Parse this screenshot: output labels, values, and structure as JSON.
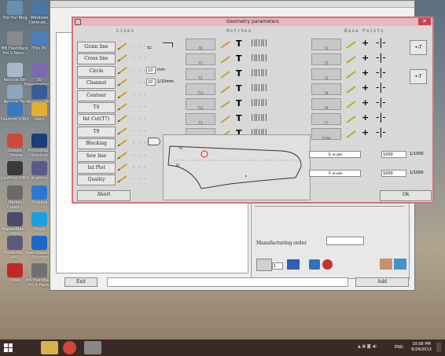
{
  "desktop_icons": [
    {
      "label": "Trio Hal Blog",
      "color": "#6a8fb0"
    },
    {
      "label": "Windows Defende...",
      "color": "#4a76a8"
    },
    {
      "label": "BB FlashBack Pro 5 Reco...",
      "color": "#8a8a8a"
    },
    {
      "label": "This PC",
      "color": "#4c7fb8"
    },
    {
      "label": "Recycle Bin",
      "color": "#a7b8c8"
    },
    {
      "label": "3D Presentations...",
      "color": "#7b6ab0"
    },
    {
      "label": "Recycle Bin",
      "color": "#8fa6b8"
    },
    {
      "label": "ModarisV8R1",
      "color": "#3a5c98"
    },
    {
      "label": "Diamino V3R2",
      "color": "#3a78c0"
    },
    {
      "label": "Paint",
      "color": "#e0b030"
    },
    {
      "label": "Google Chrome",
      "color": "#d04838"
    },
    {
      "label": "Photoshop - Shortcut",
      "color": "#1a3c78"
    },
    {
      "label": "JustPrint V3R2",
      "color": "#3a3a3a"
    },
    {
      "label": "ImgPrint",
      "color": "#5a5a8a"
    },
    {
      "label": "Marker Creati...",
      "color": "#6a6a6a"
    },
    {
      "label": "Dropbox",
      "color": "#2a78d0"
    },
    {
      "label": "MarkerMak... V8R1",
      "color": "#4a4a6a"
    },
    {
      "label": "Skype",
      "color": "#18a0e0"
    },
    {
      "label": "MarkerMa... V8R1",
      "color": "#5a5a7a"
    },
    {
      "label": "TeamViewer 9 - Shortcut",
      "color": "#1a68c8"
    },
    {
      "label": "Video",
      "color": "#c02828"
    },
    {
      "label": "BB FlashBack Pro 5 Player",
      "color": "#707070"
    }
  ],
  "dialog": {
    "title": "Geometry parameters",
    "close": "✕",
    "sections": {
      "lines": "Lines",
      "middle": "Notches",
      "right": "Base Points"
    },
    "line_buttons": [
      "Grain line",
      "Cross line",
      "Circle",
      "Channel",
      "Contour",
      "T4",
      "Int Cut(T7)",
      "T9",
      "Blocking",
      "Sew line",
      "Int Plot",
      "Quality"
    ],
    "circle_value": "10",
    "circle_unit": "mm",
    "channel_value": "10",
    "channel_unit": "1/10mm",
    "middle_tiles": [
      "T6",
      "T5",
      "T2",
      "T12",
      "T11",
      "T3",
      "T4"
    ],
    "right_tiles": [
      "T2",
      "T3",
      "T1",
      "T8",
      "T8",
      "T7",
      "Cnew"
    ],
    "x_scale_label": "X scale",
    "x_scale_value": "1000",
    "x_scale_unit": "1/1000",
    "y_scale_label": "Y scale",
    "y_scale_value": "1000",
    "y_scale_unit": "1/1000",
    "abort": "Abort",
    "ok": "Ok"
  },
  "bgapp": {
    "manufacturing_order_label": "Manufacturing order",
    "manufacturing_order_value": "",
    "counter_value": "1",
    "exit": "Exit",
    "add": "Add"
  },
  "taskbar": {
    "language": "ENG",
    "time": "10:08 PM",
    "date": "9/24/2013"
  }
}
